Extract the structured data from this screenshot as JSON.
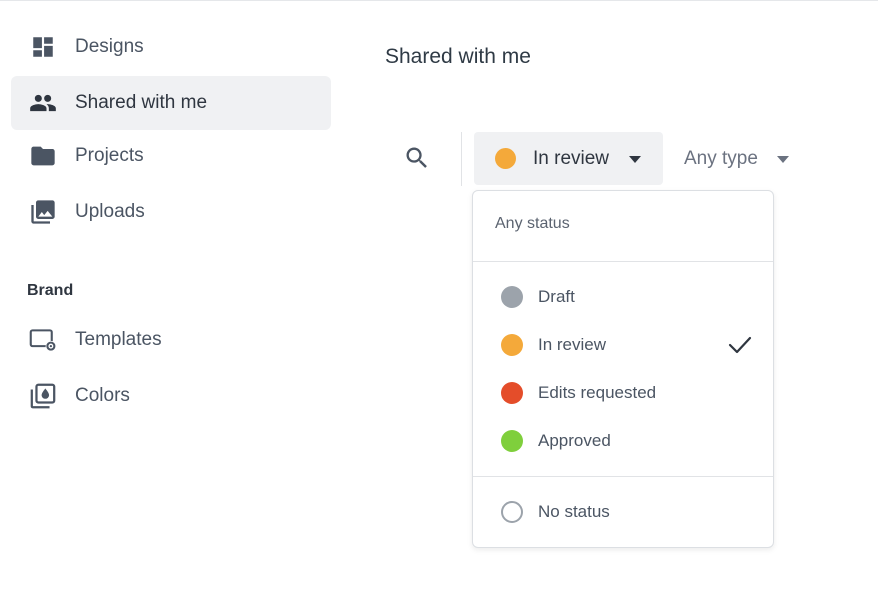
{
  "sidebar": {
    "items": [
      {
        "label": "Designs",
        "icon": "dashboard-icon"
      },
      {
        "label": "Shared with me",
        "icon": "people-icon",
        "active": true
      },
      {
        "label": "Projects",
        "icon": "folder-icon"
      },
      {
        "label": "Uploads",
        "icon": "photo-library-icon"
      }
    ],
    "brand_heading": "Brand",
    "brand_items": [
      {
        "label": "Templates",
        "icon": "template-settings-icon"
      },
      {
        "label": "Colors",
        "icon": "color-palette-icon"
      }
    ]
  },
  "main": {
    "title": "Shared with me",
    "status_filter": {
      "label": "In review",
      "dot_color": "#f4a93a"
    },
    "type_filter": {
      "label": "Any type"
    }
  },
  "dropdown": {
    "any_status": "Any status",
    "options": [
      {
        "label": "Draft",
        "color": "#9ca3ab"
      },
      {
        "label": "In review",
        "color": "#f4a93a",
        "selected": true
      },
      {
        "label": "Edits requested",
        "color": "#e44d2a"
      },
      {
        "label": "Approved",
        "color": "#7fcf3c"
      }
    ],
    "no_status": "No status"
  },
  "colors": {
    "active_bg": "#f0f1f3",
    "icon_gray": "#4b5563"
  }
}
